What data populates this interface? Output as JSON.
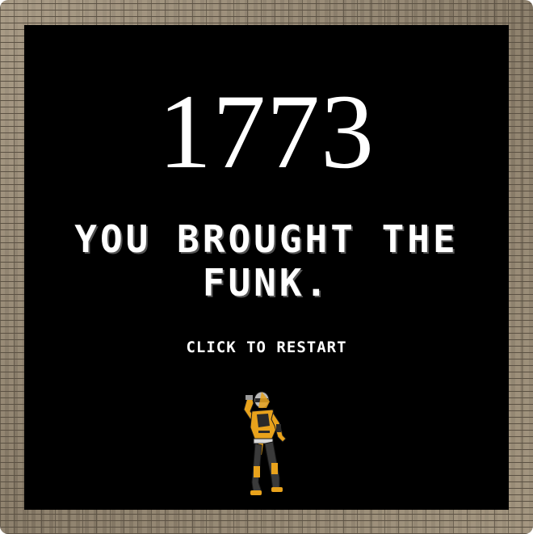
{
  "game": {
    "score": "1773",
    "message": "YOU BROUGHT THE FUNK.",
    "restart_label": "CLICK TO RESTART"
  },
  "colors": {
    "screen_background": "#000000",
    "text": "#ffffff",
    "dancer_body": "#e8a21c",
    "dancer_armor": "#2a2a2a"
  },
  "icons": {
    "character": "dancing-robot-ninja-sprite",
    "frame": "brick-wall-border"
  }
}
